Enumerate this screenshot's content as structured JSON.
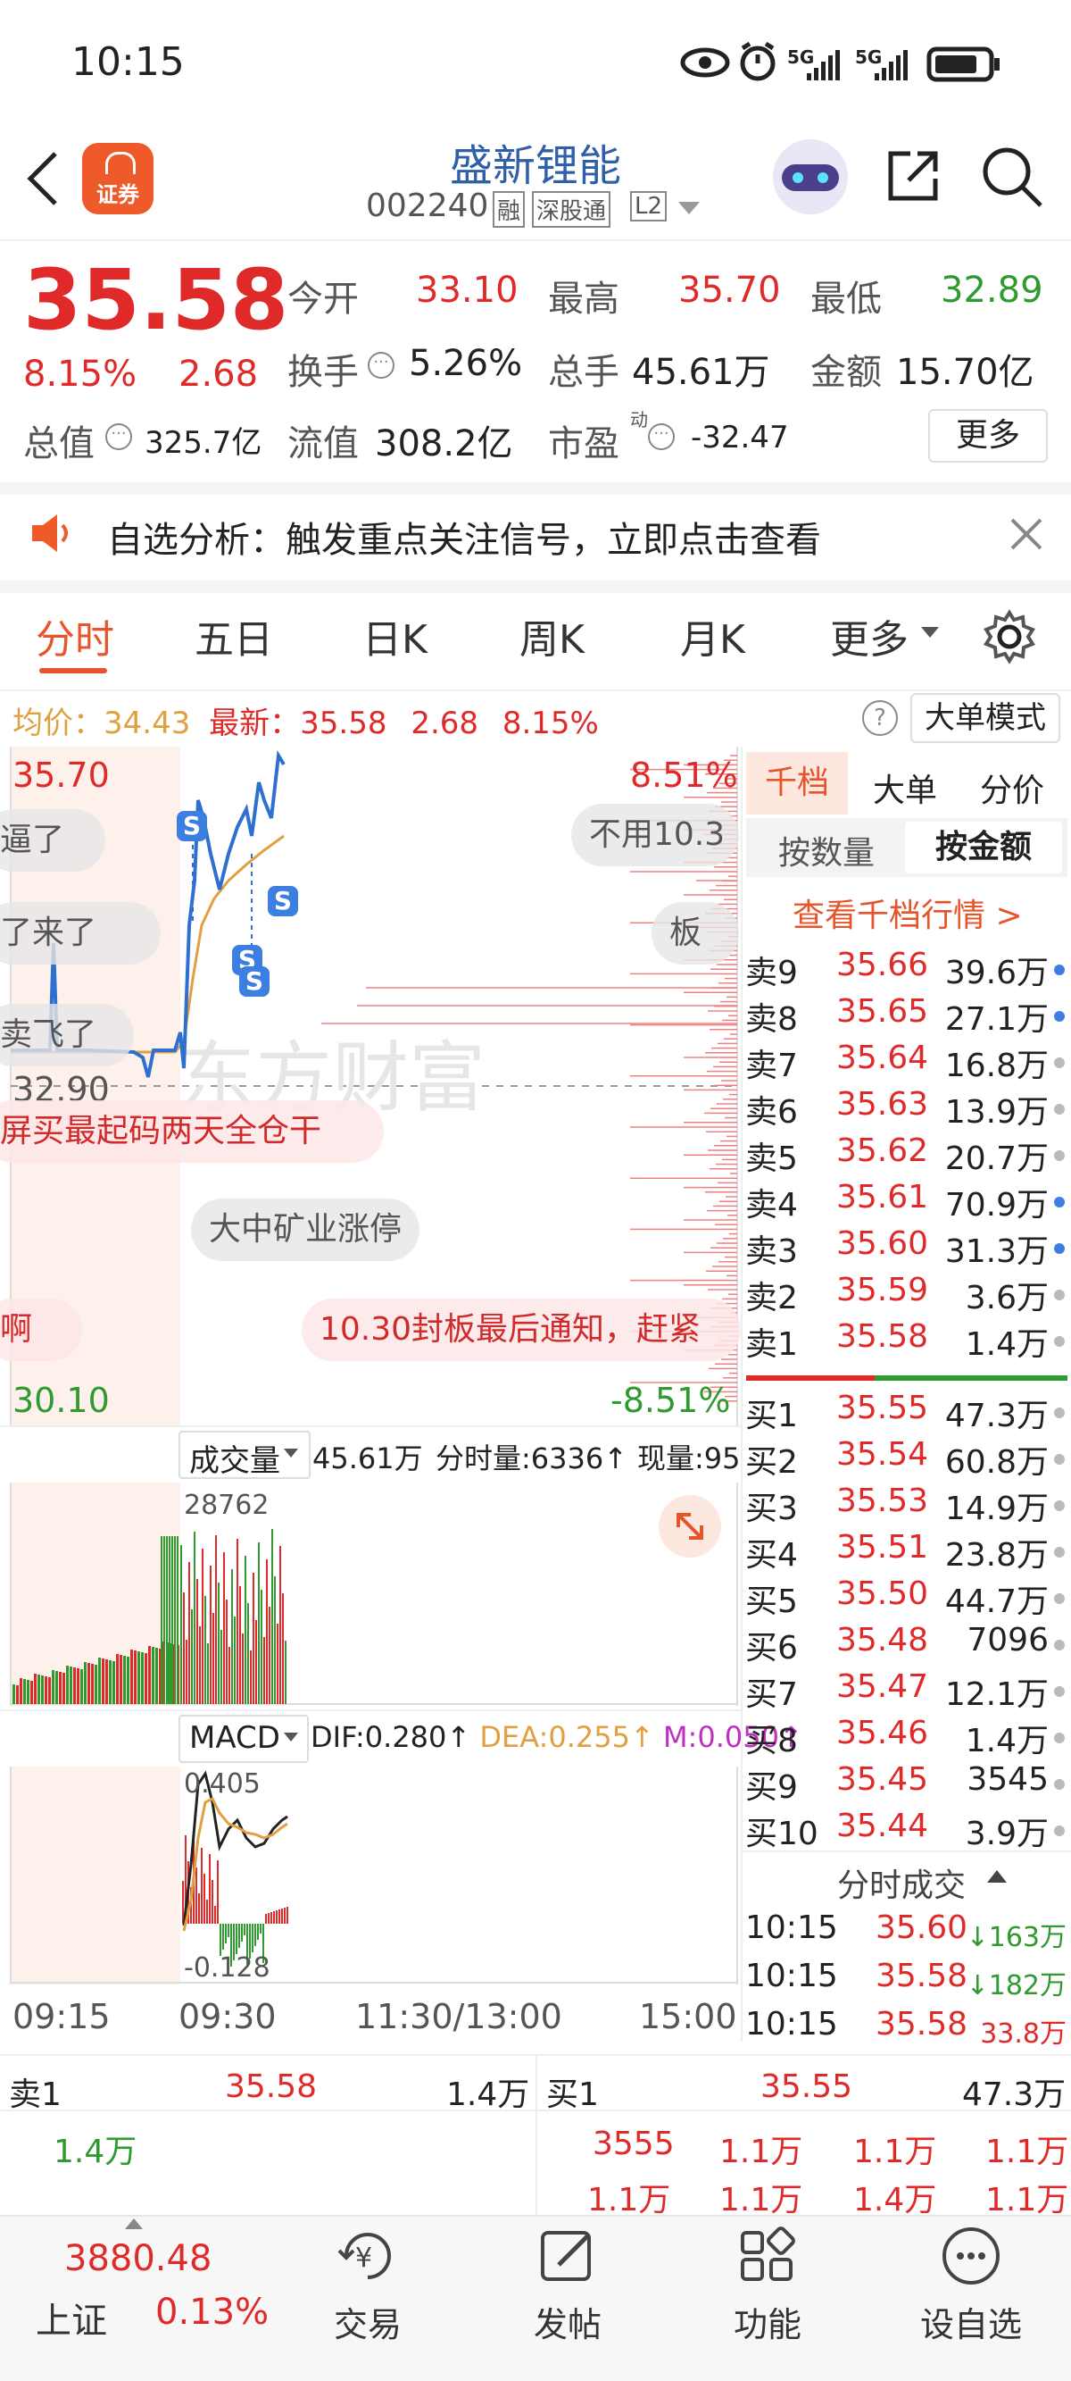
{
  "status_bar": {
    "time": "10:15",
    "net1": "5G",
    "net2": "5G"
  },
  "header": {
    "title": "盛新锂能",
    "code": "002240",
    "badge1": "融",
    "badge2": "深股通",
    "badge3": "L2",
    "logo_text": "证券"
  },
  "quote": {
    "price": "35.58",
    "change_pct": "8.15%",
    "change": "2.68",
    "open_label": "今开",
    "open": "33.10",
    "high_label": "最高",
    "high": "35.70",
    "low_label": "最低",
    "low": "32.89",
    "turnover_label": "换手",
    "turnover": "5.26%",
    "volume_label": "总手",
    "volume": "45.61万",
    "amount_label": "金额",
    "amount": "15.70亿",
    "mktcap_label": "总值",
    "mktcap": "325.7亿",
    "float_label": "流值",
    "float": "308.2亿",
    "pe_label": "市盈",
    "pe_sup": "动",
    "pe": "-32.47",
    "more_label": "更多"
  },
  "notice": {
    "text": "自选分析：触发重点关注信号，立即点击查看"
  },
  "tabs": [
    "分时",
    "五日",
    "日K",
    "周K",
    "月K",
    "更多"
  ],
  "avg_line": {
    "avg_label": "均价：",
    "avg": "34.43",
    "latest_label": "最新：",
    "latest": "35.58",
    "chg": "2.68",
    "pct": "8.15%",
    "mode_label": "大单模式"
  },
  "chart": {
    "top_price": "35.70",
    "top_pct": "8.51%",
    "mid_price": "32.90",
    "bottom_price": "30.10",
    "bottom_pct": "-8.51%",
    "watermark": "东方财富",
    "bubbles": [
      "逼了",
      "了来了",
      "卖飞了",
      "屏买最起码两天全仓干",
      "大中矿业涨停",
      "啊",
      "10.30封板最后通知，赶紧",
      "不用10.3",
      "板"
    ],
    "vol_label": "成交量",
    "vol_total": "45.61万",
    "vol_tick_label": "分时量:6336↑",
    "vol_now_label": "现量:95",
    "vol_max": "28762",
    "macd_label": "MACD",
    "dif": "DIF:0.280↑",
    "dea": "DEA:0.255↑",
    "m": "M:0.050↑",
    "macd_top": "0.405",
    "macd_bottom": "-0.128",
    "times": [
      "09:15",
      "09:30",
      "11:30/13:00",
      "15:00"
    ]
  },
  "orderbook": {
    "tabs": [
      "千档",
      "大单",
      "分价"
    ],
    "subtabs": [
      "按数量",
      "按金额"
    ],
    "link": "查看千档行情 >",
    "asks": [
      {
        "label": "卖9",
        "price": "35.66",
        "vol": "39.6万"
      },
      {
        "label": "卖8",
        "price": "35.65",
        "vol": "27.1万"
      },
      {
        "label": "卖7",
        "price": "35.64",
        "vol": "16.8万"
      },
      {
        "label": "卖6",
        "price": "35.63",
        "vol": "13.9万"
      },
      {
        "label": "卖5",
        "price": "35.62",
        "vol": "20.7万"
      },
      {
        "label": "卖4",
        "price": "35.61",
        "vol": "70.9万"
      },
      {
        "label": "卖3",
        "price": "35.60",
        "vol": "31.3万"
      },
      {
        "label": "卖2",
        "price": "35.59",
        "vol": "3.6万"
      },
      {
        "label": "卖1",
        "price": "35.58",
        "vol": "1.4万"
      }
    ],
    "bids": [
      {
        "label": "买1",
        "price": "35.55",
        "vol": "47.3万"
      },
      {
        "label": "买2",
        "price": "35.54",
        "vol": "60.8万"
      },
      {
        "label": "买3",
        "price": "35.53",
        "vol": "14.9万"
      },
      {
        "label": "买4",
        "price": "35.51",
        "vol": "23.8万"
      },
      {
        "label": "买5",
        "price": "35.50",
        "vol": "44.7万"
      },
      {
        "label": "买6",
        "price": "35.48",
        "vol": "7096"
      },
      {
        "label": "买7",
        "price": "35.47",
        "vol": "12.1万"
      },
      {
        "label": "买8",
        "price": "35.46",
        "vol": "1.4万"
      },
      {
        "label": "买9",
        "price": "35.45",
        "vol": "3545"
      },
      {
        "label": "买10",
        "price": "35.44",
        "vol": "3.9万"
      }
    ],
    "trades_title": "分时成交",
    "trades": [
      {
        "time": "10:15",
        "price": "35.60",
        "vol": "↓163万"
      },
      {
        "time": "10:15",
        "price": "35.58",
        "vol": "↓182万"
      },
      {
        "time": "10:15",
        "price": "35.58",
        "vol": "33.8万"
      }
    ]
  },
  "queue": {
    "sell_label": "卖1",
    "sell_price": "35.58",
    "sell_vol": "1.4万",
    "buy_label": "买1",
    "buy_price": "35.55",
    "buy_vol": "47.3万",
    "sell_orders": [
      "1.4万"
    ],
    "buy_orders_row1": [
      "3555",
      "1.1万",
      "1.1万",
      "1.1万"
    ],
    "buy_orders_row2": [
      "1.1万",
      "1.1万",
      "1.4万",
      "1.1万"
    ]
  },
  "bottom_nav": {
    "index_value": "3880.48",
    "index_name": "上证",
    "index_pct": "0.13%",
    "items": [
      "交易",
      "发帖",
      "功能",
      "设自选"
    ]
  },
  "colors": {
    "up": "#e02a2a",
    "down": "#2f9a2f",
    "accent": "#e8542a",
    "price_line": "#2f6fd0",
    "avg_line": "#e0a040"
  }
}
